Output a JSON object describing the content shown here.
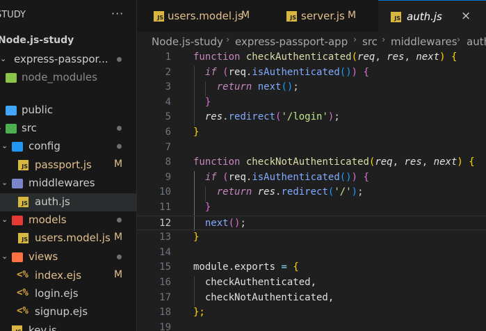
{
  "sidebar": {
    "title": "STUDY",
    "more": "···",
    "workspace": "Node.js-study",
    "tree": [
      {
        "label": "express-passpor...",
        "badge": "",
        "dot": true
      },
      {
        "label": "node_modules",
        "badge": "",
        "dot": false
      },
      {
        "label": "public",
        "badge": "",
        "dot": false
      },
      {
        "label": "src",
        "badge": "",
        "dot": true
      },
      {
        "label": "config",
        "badge": "",
        "dot": true
      },
      {
        "label": "passport.js",
        "badge": "M",
        "dot": false
      },
      {
        "label": "middlewares",
        "badge": "",
        "dot": false
      },
      {
        "label": "auth.js",
        "badge": "",
        "dot": false
      },
      {
        "label": "models",
        "badge": "",
        "dot": true
      },
      {
        "label": "users.model.js",
        "badge": "M",
        "dot": false
      },
      {
        "label": "views",
        "badge": "",
        "dot": true
      },
      {
        "label": "index.ejs",
        "badge": "M",
        "dot": false
      },
      {
        "label": "login.ejs",
        "badge": "",
        "dot": false
      },
      {
        "label": "signup.ejs",
        "badge": "",
        "dot": false
      },
      {
        "label": "key.js",
        "badge": "",
        "dot": false
      }
    ]
  },
  "tabs": [
    {
      "label": "users.model.js",
      "badge": "M"
    },
    {
      "label": "server.js",
      "badge": "M"
    },
    {
      "label": "auth.js",
      "close": "×"
    }
  ],
  "breadcrumbs": [
    "Node.js-study",
    "express-passport-app",
    "src",
    "middlewares",
    "auth.js"
  ],
  "editor": {
    "current_line": 12,
    "line_numbers": [
      "1",
      "2",
      "3",
      "4",
      "5",
      "6",
      "7",
      "8",
      "9",
      "10",
      "11",
      "12",
      "13",
      "14",
      "15",
      "16",
      "17",
      "18",
      "19"
    ],
    "tokens": {
      "kw_function": "function",
      "fn1": "checkAuthenticated",
      "fn2": "checkNotAuthenticated",
      "req": "req",
      "res": "res",
      "next": "next",
      "comma": ",",
      "kw_if": "if",
      "kw_return": "return",
      "is_auth": "isAuthenticated",
      "redirect": "redirect",
      "dot": ".",
      "semi": ";",
      "str_login": "'/login'",
      "str_root": "'/'",
      "module": "module",
      "exports": "exports",
      "eq": "=",
      "export1": "checkAuthenticated,",
      "export2": "checkNotAuthenticated,",
      "p_open": "(",
      "p_close": ")",
      "p_pair": "()",
      "c_open": "{",
      "c_close": "}",
      "c_close_semi": "};"
    }
  },
  "colors": {
    "background": "#1f1f1f",
    "sidebar_bg": "#181818",
    "modified": "#e2c08d",
    "keyword": "#c586c0",
    "function": "#dcdcaa",
    "string": "#c3e88d",
    "bracket_gold": "#ffd700",
    "bracket_purple": "#da70d6",
    "bracket_blue": "#179fff"
  }
}
